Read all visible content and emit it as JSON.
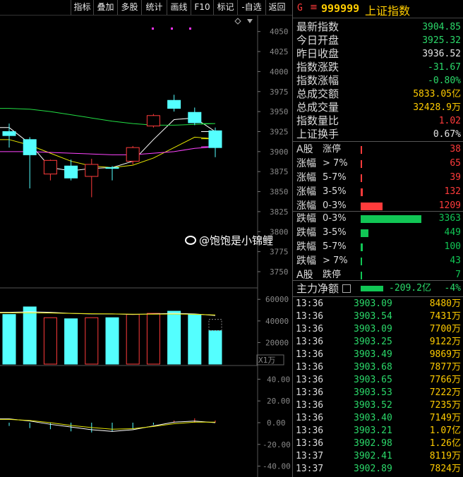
{
  "toolbar": {
    "buttons": [
      "指标",
      "叠加",
      "多股",
      "统计",
      "画线",
      "F10",
      "标记",
      "-自选",
      "返回"
    ]
  },
  "header": {
    "g_label": "G",
    "menu_icon": "≡",
    "code": "999999",
    "name": "上证指数"
  },
  "quote": {
    "rows": [
      {
        "label": "最新指数",
        "value": "3904.85",
        "color": "#2bd96a"
      },
      {
        "label": "今日开盘",
        "value": "3925.32",
        "color": "#2bd96a"
      },
      {
        "label": "昨日收盘",
        "value": "3936.52",
        "color": "#e6e6e6"
      },
      {
        "label": "指数涨跌",
        "value": "-31.67",
        "color": "#2bd96a"
      },
      {
        "label": "指数涨幅",
        "value": "-0.80%",
        "color": "#2bd96a"
      },
      {
        "label": "总成交额",
        "value": "5833.05亿",
        "color": "#ffcc00"
      },
      {
        "label": "总成交量",
        "value": "32428.9万",
        "color": "#ffcc00"
      },
      {
        "label": "指数量比",
        "value": "1.02",
        "color": "#ff3b3b"
      },
      {
        "label": "上证换手",
        "value": "0.67%",
        "color": "#e6e6e6"
      }
    ]
  },
  "distribution": {
    "up": [
      {
        "label": "A股",
        "label2": "涨停",
        "value": "38",
        "bar": 0.015
      },
      {
        "label": "涨幅",
        "label2": "> 7%",
        "value": "65",
        "bar": 0.02
      },
      {
        "label": "涨幅",
        "label2": "5-7%",
        "value": "39",
        "bar": 0.015
      },
      {
        "label": "涨幅",
        "label2": "3-5%",
        "value": "132",
        "bar": 0.04
      },
      {
        "label": "涨幅",
        "label2": "0-3%",
        "value": "1209",
        "bar": 0.36
      }
    ],
    "down": [
      {
        "label": "跌幅",
        "label2": "0-3%",
        "value": "3363",
        "bar": 1.0
      },
      {
        "label": "跌幅",
        "label2": "3-5%",
        "value": "449",
        "bar": 0.13
      },
      {
        "label": "跌幅",
        "label2": "5-7%",
        "value": "100",
        "bar": 0.04
      },
      {
        "label": "跌幅",
        "label2": "> 7%",
        "value": "43",
        "bar": 0.015
      },
      {
        "label": "A股",
        "label2": "跌停",
        "value": "7",
        "bar": 0.01
      }
    ],
    "up_color": "#ff3b3b",
    "down_color": "#11c655"
  },
  "main_force": {
    "label": "主力净额",
    "value": "-209.2亿",
    "pct": "-4%"
  },
  "ticks": [
    {
      "time": "13:36",
      "price": "3903.09",
      "volume": "8480万"
    },
    {
      "time": "13:36",
      "price": "3903.54",
      "volume": "7431万"
    },
    {
      "time": "13:36",
      "price": "3903.09",
      "volume": "7700万"
    },
    {
      "time": "13:36",
      "price": "3903.25",
      "volume": "9122万"
    },
    {
      "time": "13:36",
      "price": "3903.49",
      "volume": "9869万"
    },
    {
      "time": "13:36",
      "price": "3903.68",
      "volume": "7877万"
    },
    {
      "time": "13:36",
      "price": "3903.65",
      "volume": "7766万"
    },
    {
      "time": "13:36",
      "price": "3903.53",
      "volume": "7222万"
    },
    {
      "time": "13:36",
      "price": "3903.52",
      "volume": "7235万"
    },
    {
      "time": "13:36",
      "price": "3903.40",
      "volume": "7149万"
    },
    {
      "time": "13:36",
      "price": "3903.21",
      "volume": "1.07亿"
    },
    {
      "time": "13:36",
      "price": "3902.98",
      "volume": "1.26亿"
    },
    {
      "time": "13:37",
      "price": "3902.41",
      "volume": "8119万"
    },
    {
      "time": "13:37",
      "price": "3902.89",
      "volume": "7824万"
    }
  ],
  "watermark": "@饱饱是小锦鲤",
  "chart_data": {
    "type": "candlestick",
    "price_axis": {
      "ticks": [
        4050,
        4025,
        4000,
        3975,
        3950,
        3925,
        3900,
        3875,
        3850,
        3825,
        3800,
        3775,
        3750
      ],
      "range": [
        3735,
        4070
      ]
    },
    "candles": [
      {
        "o": 3925,
        "h": 3935,
        "l": 3905,
        "c": 3920
      },
      {
        "o": 3915,
        "h": 3918,
        "l": 3854,
        "c": 3896
      },
      {
        "o": 3872,
        "h": 3890,
        "l": 3864,
        "c": 3889
      },
      {
        "o": 3882,
        "h": 3890,
        "l": 3864,
        "c": 3867
      },
      {
        "o": 3869,
        "h": 3891,
        "l": 3843,
        "c": 3884
      },
      {
        "o": 3880,
        "h": 3882,
        "l": 3864,
        "c": 3879
      },
      {
        "o": 3888,
        "h": 3907,
        "l": 3884,
        "c": 3905
      },
      {
        "o": 3932,
        "h": 3947,
        "l": 3930,
        "c": 3945
      },
      {
        "o": 3964,
        "h": 3971,
        "l": 3950,
        "c": 3954
      },
      {
        "o": 3949,
        "h": 3955,
        "l": 3933,
        "c": 3936
      },
      {
        "o": 3926,
        "h": 3930,
        "l": 3893,
        "c": 3905
      }
    ],
    "ma_lines": [
      {
        "color": "#ffffff",
        "values": [
          3930,
          3910,
          3880,
          3876,
          3879,
          3880,
          3888,
          3915,
          3940,
          3942,
          3925
        ]
      },
      {
        "color": "#e6e600",
        "values": [
          3915,
          3908,
          3898,
          3888,
          3882,
          3880,
          3883,
          3892,
          3905,
          3918,
          3916
        ]
      },
      {
        "color": "#ff44ff",
        "values": [
          3900,
          3900,
          3899,
          3898,
          3897,
          3896,
          3896,
          3898,
          3900,
          3904,
          3906
        ]
      },
      {
        "color": "#22dd44",
        "values": [
          3954,
          3953,
          3950,
          3946,
          3942,
          3938,
          3935,
          3933,
          3933,
          3934,
          3935
        ]
      }
    ],
    "volume_axis": {
      "ticks": [
        60000,
        40000,
        20000
      ],
      "unit": "X1万",
      "range": [
        0,
        68000
      ]
    },
    "volumes": [
      {
        "v": 46000,
        "up": false
      },
      {
        "v": 53000,
        "up": false
      },
      {
        "v": 43000,
        "up": true
      },
      {
        "v": 42000,
        "up": false
      },
      {
        "v": 43000,
        "up": true
      },
      {
        "v": 43000,
        "up": false
      },
      {
        "v": 46000,
        "up": true
      },
      {
        "v": 47000,
        "up": true
      },
      {
        "v": 49000,
        "up": false
      },
      {
        "v": 46000,
        "up": false
      },
      {
        "v": 31000,
        "up": false
      }
    ],
    "volume_ma": [
      {
        "color": "#ffffff",
        "values": [
          48000,
          48500,
          48000,
          47000,
          46500,
          46500,
          46000,
          46500,
          47000,
          46500,
          45000
        ]
      },
      {
        "color": "#e6e600",
        "values": [
          47500,
          47500,
          47300,
          47000,
          46700,
          46500,
          46300,
          46300,
          46400,
          46200,
          45500
        ]
      }
    ],
    "macd_axis": {
      "ticks": [
        40.0,
        20.0,
        0.0,
        -20.0,
        -40.0
      ],
      "range": [
        -50,
        50
      ]
    },
    "macd": {
      "dif": [
        3.5,
        1.5,
        -1.5,
        -4.0,
        -6.5,
        -8.0,
        -6.5,
        -3.0,
        0.5,
        1.5,
        0.0
      ],
      "dea": [
        3.0,
        2.0,
        0.0,
        -2.5,
        -4.5,
        -6.0,
        -5.5,
        -3.5,
        -1.0,
        0.5,
        0.5
      ],
      "hist": [
        -3,
        -5,
        -6,
        -8,
        -9,
        -8,
        -6,
        -2,
        2,
        4,
        2
      ]
    }
  }
}
